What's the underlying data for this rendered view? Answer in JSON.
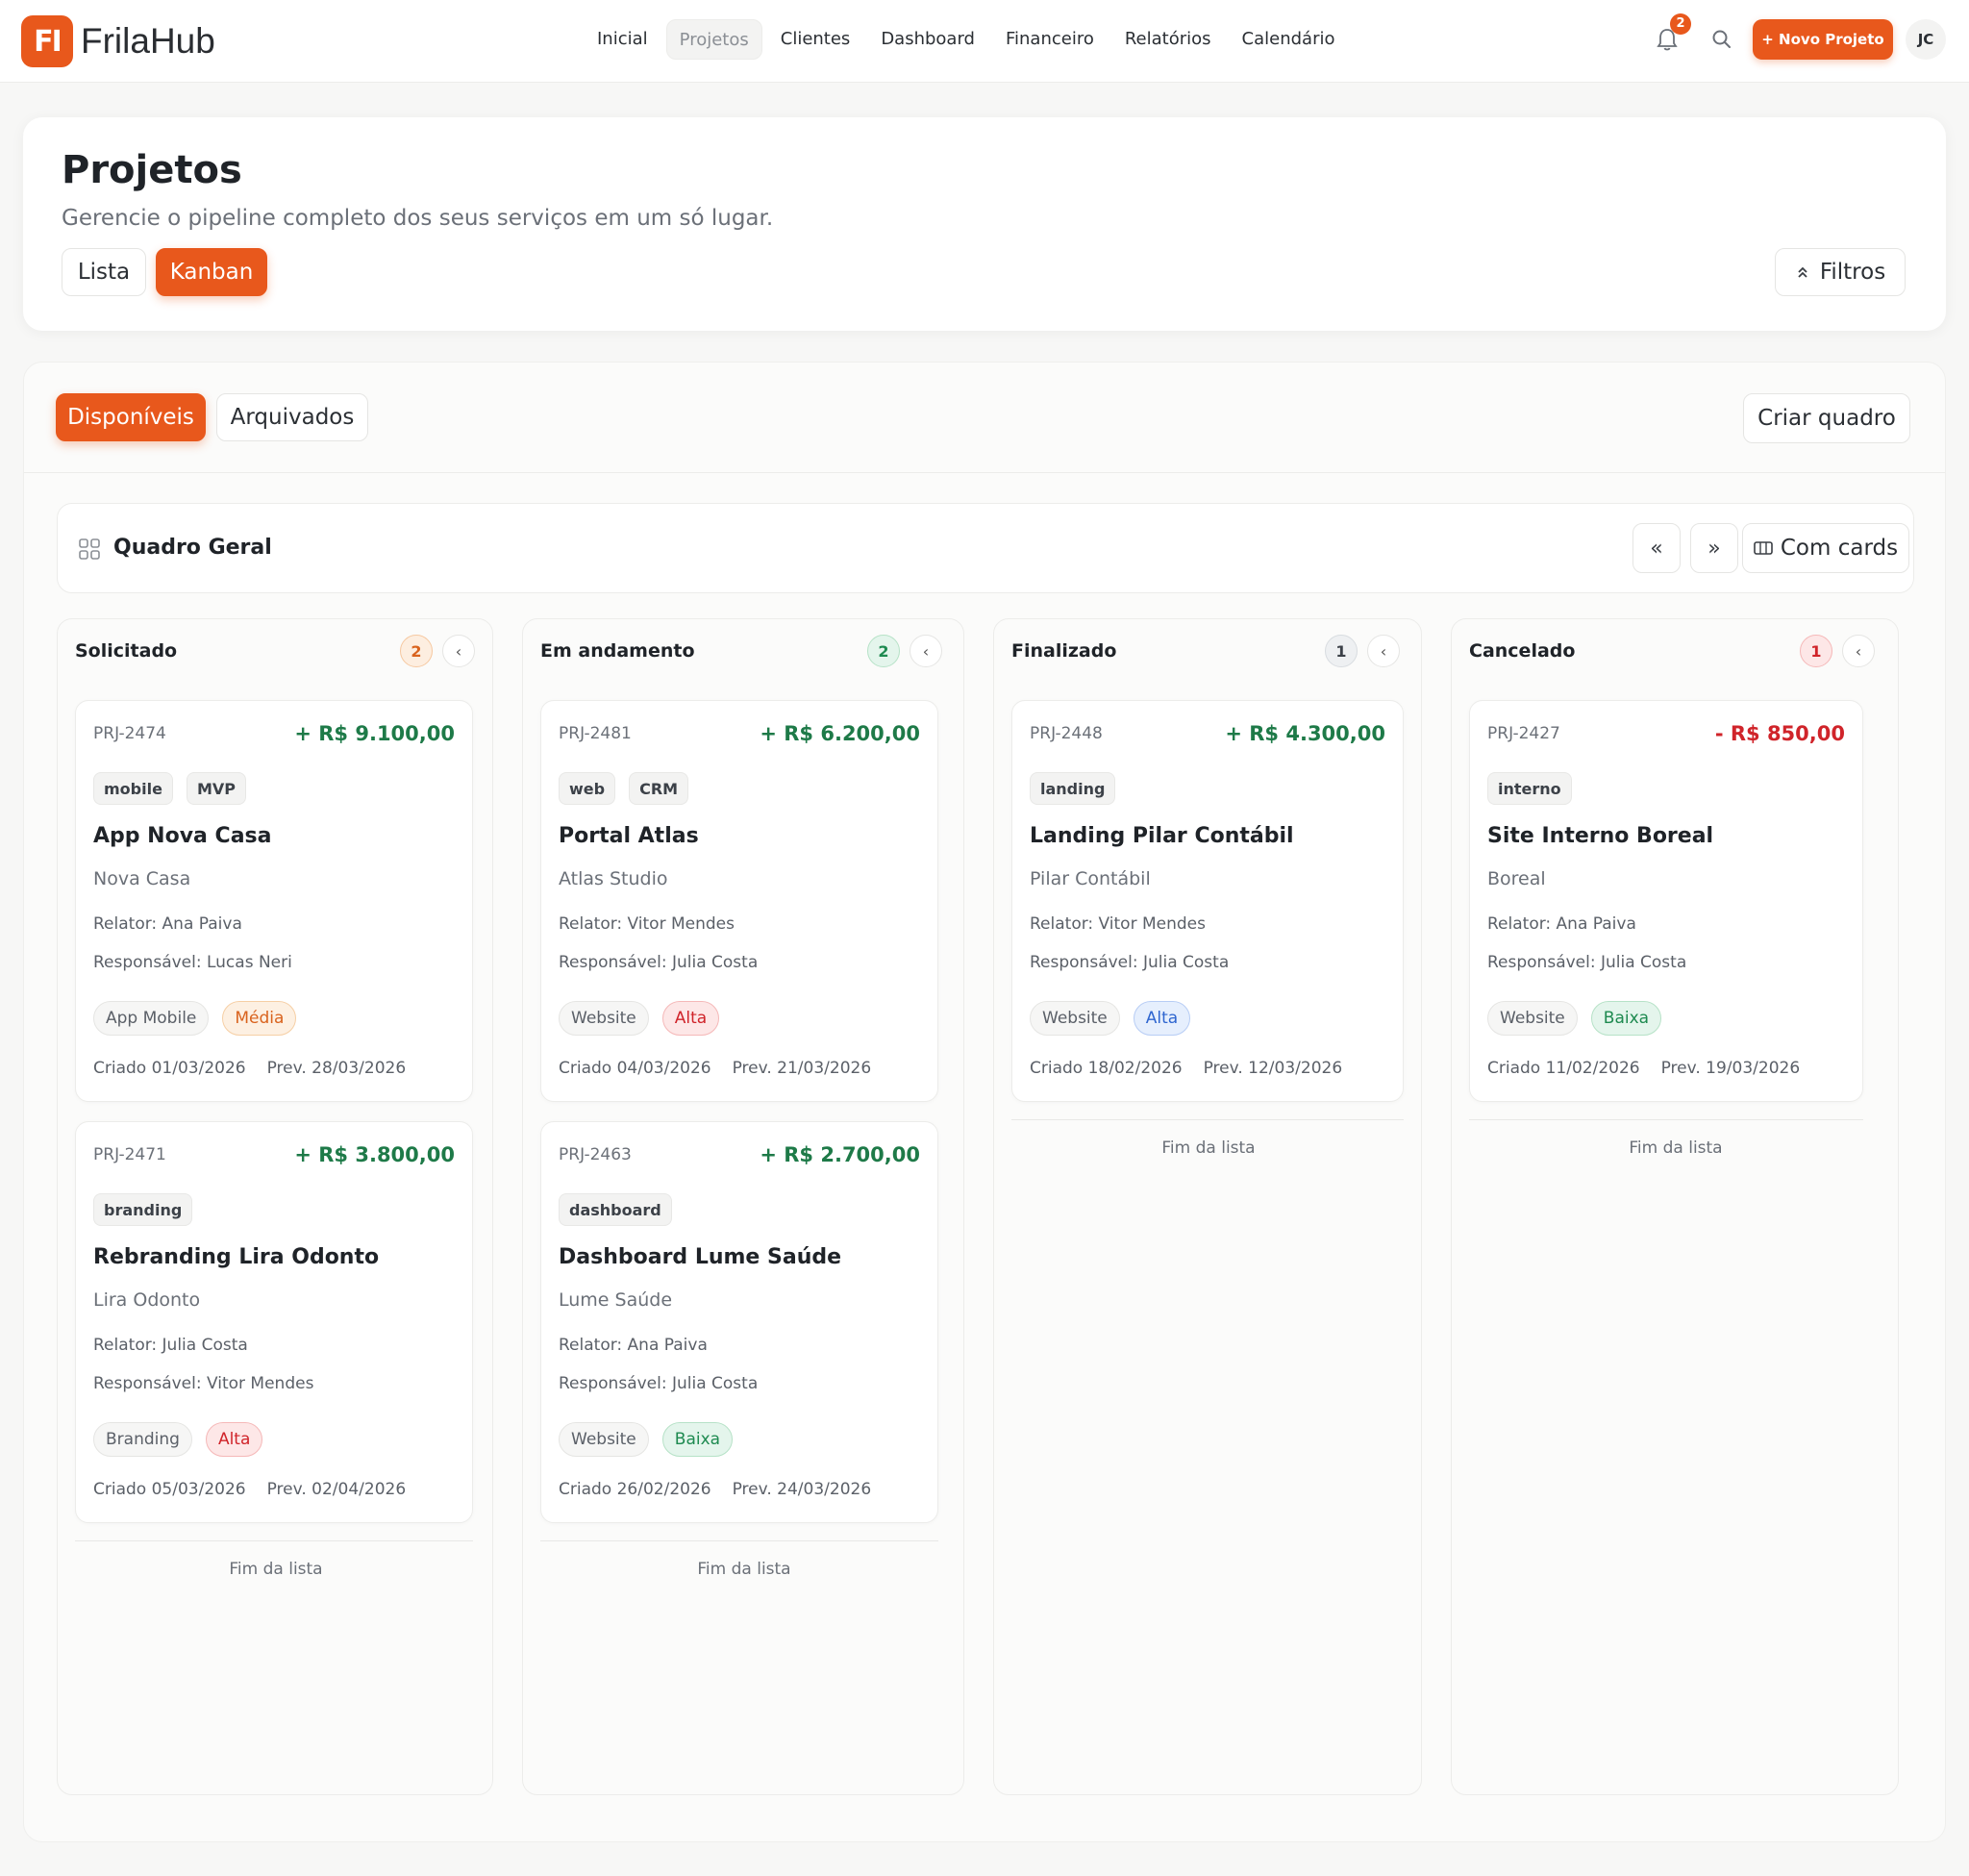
{
  "app": {
    "logo_mark": "FI",
    "name": "FrilaHub",
    "nav": [
      "Inicial",
      "Projetos",
      "Clientes",
      "Dashboard",
      "Financeiro",
      "Relatórios",
      "Calendário"
    ],
    "notifications": "2",
    "new_project": "+ Novo Projeto",
    "avatar": "JC"
  },
  "hero": {
    "title": "Projetos",
    "subtitle": "Gerencie o pipeline completo dos seus serviços em um só lugar.",
    "view_list": "Lista",
    "view_kanban": "Kanban",
    "filters": "Filtros"
  },
  "board": {
    "tab_available": "Disponíveis",
    "tab_archived": "Arquivados",
    "create_board": "Criar quadro",
    "title": "Quadro Geral",
    "with_cards": "Com cards",
    "end_of_list": "Fim da lista",
    "columns": [
      {
        "title": "Solicitado",
        "count": "2",
        "cards": [
          {
            "id": "PRJ-2474",
            "amount": "+ R$ 9.100,00",
            "tags": [
              "mobile",
              "MVP"
            ],
            "title": "App Nova Casa",
            "client": "Nova Casa",
            "relator": "Relator: Ana Paiva",
            "responsavel": "Responsável: Lucas Neri",
            "type": "App Mobile",
            "priority": "Média",
            "created": "Criado 01/03/2026",
            "due": "Prev. 28/03/2026"
          },
          {
            "id": "PRJ-2471",
            "amount": "+ R$ 3.800,00",
            "tags": [
              "branding"
            ],
            "title": "Rebranding Lira Odonto",
            "client": "Lira Odonto",
            "relator": "Relator: Julia Costa",
            "responsavel": "Responsável: Vitor Mendes",
            "type": "Branding",
            "priority": "Alta",
            "created": "Criado 05/03/2026",
            "due": "Prev. 02/04/2026"
          }
        ]
      },
      {
        "title": "Em andamento",
        "count": "2",
        "cards": [
          {
            "id": "PRJ-2481",
            "amount": "+ R$ 6.200,00",
            "tags": [
              "web",
              "CRM"
            ],
            "title": "Portal Atlas",
            "client": "Atlas Studio",
            "relator": "Relator: Vitor Mendes",
            "responsavel": "Responsável: Julia Costa",
            "type": "Website",
            "priority": "Alta",
            "created": "Criado 04/03/2026",
            "due": "Prev. 21/03/2026"
          },
          {
            "id": "PRJ-2463",
            "amount": "+ R$ 2.700,00",
            "tags": [
              "dashboard"
            ],
            "title": "Dashboard Lume Saúde",
            "client": "Lume Saúde",
            "relator": "Relator: Ana Paiva",
            "responsavel": "Responsável: Julia Costa",
            "type": "Website",
            "priority": "Baixa",
            "created": "Criado 26/02/2026",
            "due": "Prev. 24/03/2026"
          }
        ]
      },
      {
        "title": "Finalizado",
        "count": "1",
        "cards": [
          {
            "id": "PRJ-2448",
            "amount": "+ R$ 4.300,00",
            "tags": [
              "landing"
            ],
            "title": "Landing Pilar Contábil",
            "client": "Pilar Contábil",
            "relator": "Relator: Vitor Mendes",
            "responsavel": "Responsável: Julia Costa",
            "type": "Website",
            "priority": "Alta",
            "created": "Criado 18/02/2026",
            "due": "Prev. 12/03/2026"
          }
        ]
      },
      {
        "title": "Cancelado",
        "count": "1",
        "cards": [
          {
            "id": "PRJ-2427",
            "amount": "- R$ 850,00",
            "tags": [
              "interno"
            ],
            "title": "Site Interno Boreal",
            "client": "Boreal",
            "relator": "Relator: Ana Paiva",
            "responsavel": "Responsável: Julia Costa",
            "type": "Website",
            "priority": "Baixa",
            "created": "Criado 11/02/2026",
            "due": "Prev. 19/03/2026"
          }
        ]
      }
    ]
  },
  "colors": {
    "accent": "#e8581c",
    "positive": "#1e7a48",
    "negative": "#d0242a"
  }
}
